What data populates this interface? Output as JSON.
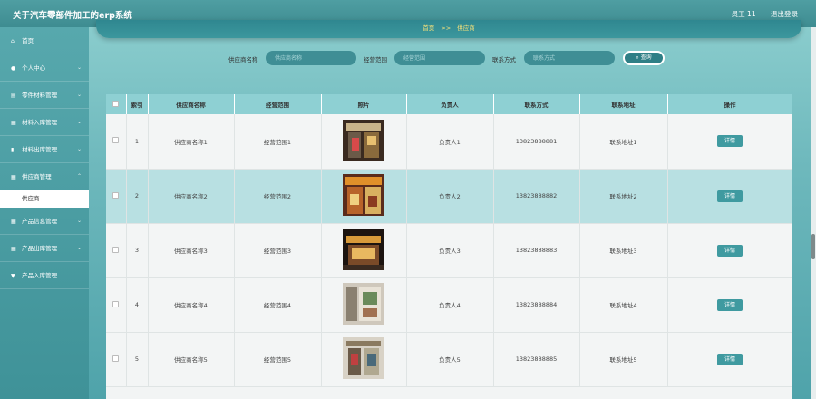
{
  "header": {
    "title": "关于汽车零部件加工的erp系统",
    "user": "员工 11",
    "logout": "退出登录"
  },
  "sidebar": {
    "items": [
      {
        "label": "首页",
        "icon": "home-icon",
        "glyph": "⌂"
      },
      {
        "label": "个人中心",
        "icon": "user-icon",
        "glyph": "👤"
      },
      {
        "label": "零件材料管理",
        "icon": "list-icon",
        "glyph": "▤"
      },
      {
        "label": "材料入库管理",
        "icon": "grid-icon",
        "glyph": "▦"
      },
      {
        "label": "材料出库管理",
        "icon": "chart-icon",
        "glyph": "▮"
      },
      {
        "label": "供应商管理",
        "icon": "grid-icon",
        "glyph": "▦"
      },
      {
        "label": "产品信息管理",
        "icon": "grid-icon",
        "glyph": "▦"
      },
      {
        "label": "产品出库管理",
        "icon": "grid-icon",
        "glyph": "▦"
      },
      {
        "label": "产品入库管理",
        "icon": "filter-icon",
        "glyph": "▼"
      }
    ],
    "active_sub": "供应商"
  },
  "breadcrumb": {
    "home": "首页",
    "sep": ">>",
    "current": "供应商"
  },
  "search": {
    "name_label": "供应商名称",
    "name_placeholder": "供应商名称",
    "scope_label": "经营范围",
    "scope_placeholder": "经营范围",
    "contact_label": "联系方式",
    "contact_placeholder": "联系方式",
    "button": "查询"
  },
  "table": {
    "columns": [
      "索引",
      "供应商名称",
      "经营范围",
      "照片",
      "负责人",
      "联系方式",
      "联系地址",
      "操作"
    ],
    "detail_label": "详情",
    "rows": [
      {
        "index": "1",
        "name": "供应商名称1",
        "scope": "经营范围1",
        "person": "负责人1",
        "phone": "13823888881",
        "address": "联系地址1"
      },
      {
        "index": "2",
        "name": "供应商名称2",
        "scope": "经营范围2",
        "person": "负责人2",
        "phone": "13823888882",
        "address": "联系地址2"
      },
      {
        "index": "3",
        "name": "供应商名称3",
        "scope": "经营范围3",
        "person": "负责人3",
        "phone": "13823888883",
        "address": "联系地址3"
      },
      {
        "index": "4",
        "name": "供应商名称4",
        "scope": "经营范围4",
        "person": "负责人4",
        "phone": "13823888884",
        "address": "联系地址4"
      },
      {
        "index": "5",
        "name": "供应商名称5",
        "scope": "经营范围5",
        "person": "负责人5",
        "phone": "13823888885",
        "address": "联系地址5"
      }
    ]
  }
}
